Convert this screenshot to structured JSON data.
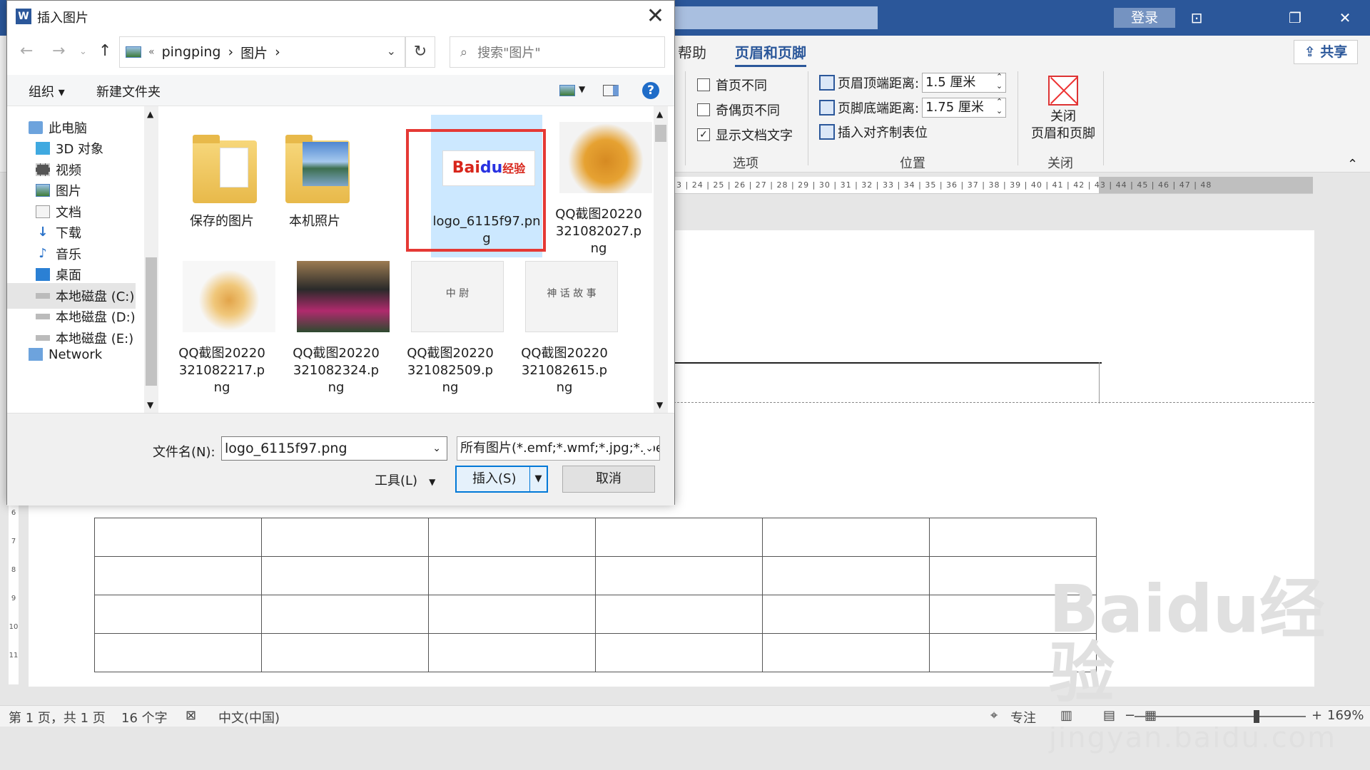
{
  "word": {
    "login": "登录",
    "tabs": [
      "帮助",
      "页眉和页脚"
    ],
    "share": "共享",
    "options": [
      "首页不同",
      "奇偶页不同",
      "显示文档文字"
    ],
    "options_checked": [
      false,
      false,
      true
    ],
    "position": {
      "header_top_label": "页眉顶端距离:",
      "header_top_value": "1.5 厘米",
      "footer_bottom_label": "页脚底端距离:",
      "footer_bottom_value": "1.75 厘米",
      "insert_tab": "插入对齐制表位"
    },
    "close": {
      "line1": "关闭",
      "line2": "页眉和页脚"
    },
    "group_labels": {
      "options": "选项",
      "position": "位置",
      "close": "关闭"
    },
    "ruler_ticks": "23 | 24 | 25 | 26 | 27 | 28 | 29 | 30 | 31 | 32 | 33 | 34 | 35 | 36 | 37 | 38 | 39 | 40 | 41 | 42 | 43 | 44 | 45 | 46 | 47 | 48",
    "vruler_ticks": [
      "6",
      "7",
      "8",
      "9",
      "10",
      "11",
      "12"
    ],
    "watermark": "Baidu经验",
    "watermark_url": "jingyan.baidu.com",
    "status": {
      "page": "第 1 页，共 1 页",
      "words": "16 个字",
      "lang": "中文(中国)",
      "focus": "专注",
      "zoom": "169%"
    }
  },
  "dialog": {
    "title": "插入图片",
    "breadcrumb": [
      "«",
      "pingping",
      "›",
      "图片",
      "›"
    ],
    "search_placeholder": "搜索\"图片\"",
    "toolbar": {
      "organize": "组织 ▾",
      "new_folder": "新建文件夹"
    },
    "nav": [
      {
        "label": "此电脑",
        "icon": "computer-icon"
      },
      {
        "label": "3D 对象",
        "icon": "cube-icon"
      },
      {
        "label": "视频",
        "icon": "video-icon"
      },
      {
        "label": "图片",
        "icon": "pictures-icon"
      },
      {
        "label": "文档",
        "icon": "document-icon"
      },
      {
        "label": "下载",
        "icon": "download-icon"
      },
      {
        "label": "音乐",
        "icon": "music-icon"
      },
      {
        "label": "桌面",
        "icon": "desktop-icon"
      },
      {
        "label": "本地磁盘 (C:)",
        "icon": "drive-icon"
      },
      {
        "label": "本地磁盘 (D:)",
        "icon": "drive-icon"
      },
      {
        "label": "本地磁盘 (E:)",
        "icon": "drive-icon"
      },
      {
        "label": "Network",
        "icon": "network-icon"
      }
    ],
    "files": [
      {
        "name": "保存的图片",
        "kind": "folder"
      },
      {
        "name": "本机照片",
        "kind": "photo-folder"
      },
      {
        "name": "logo_6115f97.png",
        "kind": "baidu"
      },
      {
        "name": "QQ截图20220321082027.png",
        "kind": "food"
      },
      {
        "name": "QQ截图20220321082217.png",
        "kind": "bottle"
      },
      {
        "name": "QQ截图20220321082324.png",
        "kind": "people"
      },
      {
        "name": "QQ截图20220321082509.png",
        "kind": "card1"
      },
      {
        "name": "QQ截图20220321082615.png",
        "kind": "card2"
      }
    ],
    "thumb_texts": {
      "baidu_bai": "Bai",
      "baidu_du": "du",
      "baidu_jy": "经验",
      "card1": "中 尉",
      "card2": "神 话 故 事"
    },
    "filename_label": "文件名(N):",
    "filename_value": "logo_6115f97.png",
    "filetype_value": "所有图片(*.emf;*.wmf;*.jpg;*.jpeg",
    "tools_label": "工具(L)",
    "insert_label": "插入(S)",
    "cancel_label": "取消"
  }
}
